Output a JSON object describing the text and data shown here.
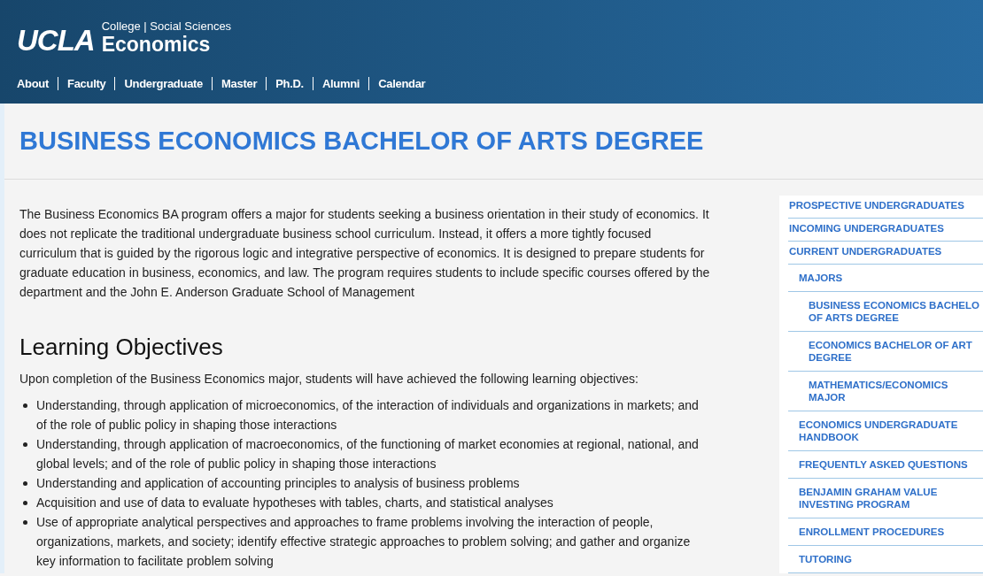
{
  "header": {
    "logo": "UCLA",
    "college": "College | Social Sciences",
    "department": "Economics",
    "nav": [
      "About",
      "Faculty",
      "Undergraduate",
      "Master",
      "Ph.D.",
      "Alumni",
      "Calendar"
    ]
  },
  "page_title": "BUSINESS ECONOMICS BACHELOR OF ARTS DEGREE",
  "intro": "The Business Economics BA program offers a major for students seeking a business orientation in their study of economics. It does not replicate the traditional undergraduate business school curriculum. Instead, it offers a more tightly focused curriculum that is guided by the rigorous logic and integrative perspective of economics. It is designed to prepare students for graduate education in business, economics, and law. The program requires students to include specific courses offered by the department and the John E. Anderson Graduate School of Management",
  "section_heading": "Learning Objectives",
  "section_lead": "Upon completion of the Business Economics major, students will have achieved the following learning objectives:",
  "objectives": [
    "Understanding, through application of microeconomics, of the interaction of individuals and organizations in markets; and of the role of public policy in shaping those interactions",
    "Understanding, through application of macroeconomics, of the functioning of market economies at regional, national, and global levels; and of the role of public policy in shaping those interactions",
    "Understanding and application of accounting principles to analysis of business problems",
    "Acquisition and use of data to evaluate hypotheses with tables, charts, and statistical analyses",
    "Use of appropriate analytical perspectives and approaches to frame problems involving the interaction of people, organizations, markets, and society; identify effective strategic approaches to problem solving; and gather and organize key information to facilitate problem solving"
  ],
  "sidebar": {
    "items": [
      {
        "text": "PROSPECTIVE UNDERGRADUATES"
      },
      {
        "text": "INCOMING UNDERGRADUATES"
      },
      {
        "text": "CURRENT UNDERGRADUATES",
        "children": [
          {
            "text": "MAJORS",
            "children": [
              {
                "text": "BUSINESS ECONOMICS BACHELO\nOF ARTS DEGREE"
              },
              {
                "text": "ECONOMICS BACHELOR OF ART\nDEGREE"
              },
              {
                "text": "MATHEMATICS/ECONOMICS\nMAJOR"
              }
            ]
          },
          {
            "text": "ECONOMICS UNDERGRADUATE\nHANDBOOK"
          },
          {
            "text": "FREQUENTLY ASKED QUESTIONS"
          },
          {
            "text": "BENJAMIN GRAHAM VALUE\nINVESTING PROGRAM"
          },
          {
            "text": "ENROLLMENT PROCEDURES"
          },
          {
            "text": "TUTORING"
          }
        ]
      }
    ]
  }
}
